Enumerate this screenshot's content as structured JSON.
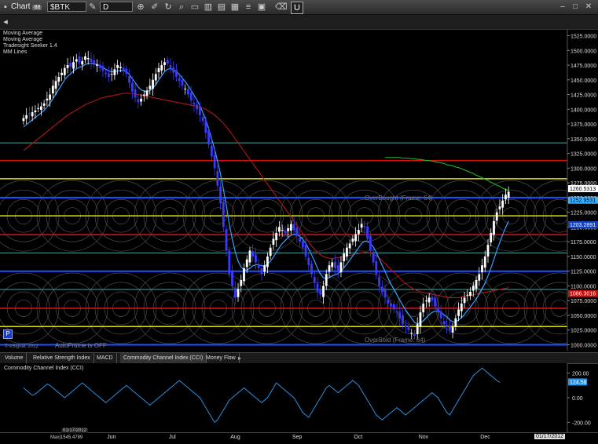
{
  "window": {
    "title": "Chart",
    "badge": "88"
  },
  "toolbar": {
    "symbol": "$BTK",
    "interval": "D",
    "symbol_icon": "edit-icon",
    "icons": [
      "crosshair-icon",
      "pencil-icon",
      "cycle-icon",
      "magnify-icon",
      "ruler-icon",
      "bar-chart-icon",
      "mini-chart-icon",
      "ml-chart-icon",
      "list-icon",
      "calendar-icon",
      "eraser-icon",
      "u-icon"
    ]
  },
  "window_controls": [
    "minimize-icon",
    "maximize-icon",
    "close-icon"
  ],
  "studies": [
    "Moving Average",
    "Moving Average",
    "Tradesight Seeker 1.4",
    "MM Lines"
  ],
  "labels": {
    "overbought": "OverBought (Frame: 64)",
    "oversold": "OverSold (Frame: 64)",
    "autoframe": "AutoFrame is OFF",
    "copyright": "© eSignal, 2012",
    "cci_title": "Commodity Channel Index (CCI)",
    "p_button": "P"
  },
  "tabs": [
    "Volume",
    "Relative Strength Index",
    "MACD",
    "Commodity Channel Index (CCI)",
    "Money Flow"
  ],
  "active_tab": 3,
  "chart_data": {
    "type": "candlestick",
    "y_ticks": [
      "1525.0000",
      "1500.0000",
      "1475.0000",
      "1450.0000",
      "1425.0000",
      "1400.0000",
      "1375.0000",
      "1350.0000",
      "1325.0000",
      "1300.0000",
      "1275.0000",
      "1250.0000",
      "1225.0000",
      "1200.0000",
      "1175.0000",
      "1150.0000",
      "1125.0000",
      "1100.0000",
      "1075.0000",
      "1050.0000",
      "1025.0000",
      "1000.0000"
    ],
    "ylim": [
      990,
      1535
    ],
    "x_ticks": [
      "Jun",
      "Jul",
      "Aug",
      "Sep",
      "Oct",
      "Nov",
      "Dec",
      "2012"
    ],
    "x_ticks_idx": [
      30,
      51,
      72,
      93,
      114,
      136,
      157,
      178
    ],
    "x_range": [
      -8,
      185
    ],
    "price_labels": [
      {
        "text": "1260.5313",
        "value": 1260.5,
        "bg": "#ffffff",
        "fg": "#000000"
      },
      {
        "text": "1252.9531",
        "value": 1252.9,
        "bg": "#3fb0ff",
        "fg": "#000000"
      },
      {
        "text": "1203.2891",
        "value": 1203.3,
        "bg": "#1040c0",
        "fg": "#ffffff"
      },
      {
        "text": "1086.3016",
        "value": 1086.3,
        "bg": "#c01010",
        "fg": "#ffffff"
      }
    ],
    "mm_lines": [
      {
        "value": 1343,
        "color": "#4aa3a3",
        "width": 1
      },
      {
        "value": 1313,
        "color": "#e01010",
        "width": 1.5
      },
      {
        "value": 1282,
        "color": "#e0e000",
        "width": 1.5
      },
      {
        "value": 1250,
        "color": "#2050ff",
        "width": 2
      },
      {
        "value": 1219,
        "color": "#e0e000",
        "width": 1.5
      },
      {
        "value": 1187,
        "color": "#e01010",
        "width": 1.5
      },
      {
        "value": 1156,
        "color": "#4aa3a3",
        "width": 1
      },
      {
        "value": 1125,
        "color": "#2050ff",
        "width": 2
      },
      {
        "value": 1094,
        "color": "#4aa3a3",
        "width": 1
      },
      {
        "value": 1062,
        "color": "#e01010",
        "width": 1.5
      },
      {
        "value": 1031,
        "color": "#e0e000",
        "width": 1.5
      },
      {
        "value": 1000,
        "color": "#2050ff",
        "width": 2
      }
    ],
    "series": [
      {
        "name": "price",
        "color_up": "#ffffff",
        "color_down": "#3a3aff",
        "close": [
          1385,
          1390,
          1392,
          1395,
          1398,
          1402,
          1405,
          1410,
          1418,
          1425,
          1440,
          1448,
          1455,
          1462,
          1470,
          1475,
          1472,
          1480,
          1485,
          1478,
          1482,
          1490,
          1487,
          1480,
          1478,
          1476,
          1470,
          1465,
          1460,
          1455,
          1460,
          1468,
          1475,
          1472,
          1466,
          1460,
          1445,
          1430,
          1420,
          1412,
          1418,
          1425,
          1432,
          1440,
          1450,
          1460,
          1470,
          1475,
          1480,
          1478,
          1470,
          1462,
          1455,
          1448,
          1440,
          1435,
          1425,
          1415,
          1408,
          1400,
          1390,
          1380,
          1360,
          1340,
          1320,
          1300,
          1270,
          1240,
          1200,
          1160,
          1120,
          1100,
          1080,
          1095,
          1110,
          1130,
          1145,
          1160,
          1150,
          1140,
          1130,
          1120,
          1135,
          1150,
          1165,
          1180,
          1190,
          1200,
          1195,
          1190,
          1198,
          1205,
          1195,
          1185,
          1175,
          1165,
          1150,
          1135,
          1120,
          1105,
          1090,
          1085,
          1100,
          1120,
          1135,
          1140,
          1130,
          1125,
          1140,
          1155,
          1165,
          1172,
          1180,
          1188,
          1195,
          1205,
          1200,
          1180,
          1160,
          1140,
          1120,
          1100,
          1090,
          1080,
          1070,
          1065,
          1060,
          1055,
          1045,
          1035,
          1030,
          1025,
          1020,
          1015,
          1035,
          1055,
          1070,
          1075,
          1080,
          1075,
          1065,
          1055,
          1045,
          1035,
          1030,
          1025,
          1030,
          1045,
          1060,
          1070,
          1080,
          1085,
          1090,
          1100,
          1110,
          1120,
          1135,
          1150,
          1170,
          1190,
          1210,
          1225,
          1235,
          1245,
          1255,
          1260
        ]
      },
      {
        "name": "ma_fast",
        "color": "#3aa0ff",
        "values": [
          1370,
          1374,
          1378,
          1382,
          1386,
          1390,
          1394,
          1398,
          1404,
          1410,
          1418,
          1426,
          1434,
          1442,
          1450,
          1456,
          1460,
          1465,
          1469,
          1471,
          1473,
          1476,
          1478,
          1478,
          1477,
          1476,
          1474,
          1471,
          1468,
          1465,
          1464,
          1464,
          1465,
          1466,
          1466,
          1464,
          1459,
          1452,
          1445,
          1438,
          1433,
          1431,
          1430,
          1432,
          1436,
          1442,
          1450,
          1457,
          1464,
          1468,
          1469,
          1467,
          1464,
          1459,
          1453,
          1447,
          1440,
          1432,
          1424,
          1416,
          1406,
          1395,
          1382,
          1367,
          1350,
          1332,
          1312,
          1290,
          1264,
          1236,
          1205,
          1180,
          1158,
          1142,
          1132,
          1127,
          1127,
          1130,
          1134,
          1136,
          1136,
          1134,
          1134,
          1137,
          1142,
          1149,
          1157,
          1165,
          1172,
          1177,
          1182,
          1186,
          1188,
          1187,
          1184,
          1179,
          1172,
          1163,
          1153,
          1142,
          1130,
          1120,
          1114,
          1112,
          1114,
          1117,
          1119,
          1121,
          1125,
          1131,
          1137,
          1144,
          1151,
          1158,
          1165,
          1172,
          1176,
          1176,
          1172,
          1166,
          1157,
          1146,
          1135,
          1124,
          1113,
          1103,
          1094,
          1085,
          1076,
          1067,
          1059,
          1052,
          1045,
          1038,
          1036,
          1037,
          1041,
          1046,
          1051,
          1055,
          1057,
          1057,
          1055,
          1051,
          1047,
          1042,
          1039,
          1039,
          1042,
          1046,
          1052,
          1058,
          1064,
          1071,
          1078,
          1086,
          1095,
          1105,
          1117,
          1130,
          1145,
          1160,
          1174,
          1187,
          1199,
          1210
        ]
      },
      {
        "name": "ma_slow",
        "color": "#c01818",
        "values": [
          1330,
          1334,
          1338,
          1342,
          1346,
          1350,
          1354,
          1358,
          1362,
          1366,
          1370,
          1374,
          1378,
          1382,
          1386,
          1390,
          1393,
          1396,
          1399,
          1402,
          1405,
          1408,
          1410,
          1412,
          1414,
          1416,
          1418,
          1420,
          1421,
          1422,
          1423,
          1424,
          1425,
          1426,
          1427,
          1427,
          1427,
          1427,
          1426,
          1425,
          1424,
          1423,
          1422,
          1421,
          1420,
          1419,
          1418,
          1417,
          1416,
          1415,
          1414,
          1413,
          1412,
          1411,
          1410,
          1409,
          1408,
          1407,
          1406,
          1405,
          1404,
          1402,
          1400,
          1397,
          1394,
          1390,
          1386,
          1381,
          1376,
          1370,
          1364,
          1357,
          1350,
          1343,
          1336,
          1329,
          1322,
          1315,
          1308,
          1301,
          1294,
          1287,
          1280,
          1273,
          1266,
          1259,
          1252,
          1245,
          1238,
          1231,
          1224,
          1217,
          1210,
          1203,
          1196,
          1189,
          1182,
          1175,
          1168,
          1162,
          1157,
          1153,
          1150,
          1148,
          1147,
          1147,
          1147,
          1148,
          1149,
          1150,
          1151,
          1152,
          1153,
          1154,
          1155,
          1156,
          1157,
          1157,
          1156,
          1154,
          1151,
          1147,
          1143,
          1138,
          1133,
          1128,
          1123,
          1118,
          1113,
          1108,
          1104,
          1100,
          1097,
          1094,
          1092,
          1090,
          1089,
          1088,
          1087,
          1086,
          1085,
          1084,
          1083,
          1082,
          1081,
          1080,
          1080,
          1080,
          1080,
          1081,
          1082,
          1083,
          1084,
          1085,
          1086,
          1087,
          1088,
          1089,
          1090,
          1091,
          1092,
          1093,
          1094,
          1095,
          1096,
          1097
        ]
      },
      {
        "name": "ma_long",
        "color": "#20c020",
        "values": [
          1318,
          1318,
          1318,
          1318,
          1318,
          1318,
          1317,
          1317,
          1317,
          1316,
          1316,
          1315,
          1315,
          1314,
          1313,
          1313,
          1312,
          1311,
          1310,
          1309,
          1308,
          1306,
          1305,
          1304,
          1302,
          1301,
          1299,
          1297,
          1295,
          1293,
          1291,
          1288,
          1286,
          1284,
          1281,
          1279,
          1276,
          1274,
          1271,
          1269,
          1266,
          1264,
          1262
        ]
      },
      {
        "name": "cci",
        "color": "#2a90e0",
        "values": [
          80,
          60,
          40,
          20,
          30,
          50,
          70,
          90,
          110,
          100,
          80,
          60,
          40,
          20,
          0,
          20,
          40,
          60,
          80,
          100,
          120,
          100,
          80,
          60,
          40,
          20,
          0,
          -20,
          -40,
          -20,
          0,
          20,
          40,
          60,
          80,
          100,
          80,
          60,
          40,
          20,
          0,
          -20,
          -40,
          -60,
          -40,
          -20,
          0,
          20,
          40,
          60,
          80,
          100,
          120,
          140,
          120,
          100,
          80,
          60,
          40,
          20,
          0,
          -40,
          -80,
          -120,
          -160,
          -200,
          -180,
          -140,
          -100,
          -60,
          -20,
          0,
          20,
          40,
          60,
          80,
          60,
          40,
          20,
          0,
          -20,
          -40,
          -20,
          0,
          40,
          80,
          120,
          100,
          80,
          60,
          40,
          20,
          0,
          -40,
          -80,
          -120,
          -140,
          -160,
          -120,
          -80,
          -40,
          0,
          40,
          80,
          100,
          80,
          60,
          40,
          60,
          80,
          100,
          120,
          140,
          120,
          100,
          60,
          20,
          -20,
          -60,
          -100,
          -140,
          -160,
          -180,
          -160,
          -140,
          -120,
          -100,
          -80,
          -100,
          -120,
          -140,
          -120,
          -100,
          -80,
          -60,
          -40,
          -20,
          0,
          20,
          40,
          20,
          0,
          -40,
          -80,
          -120,
          -140,
          -100,
          -60,
          -20,
          20,
          60,
          100,
          140,
          180,
          200,
          220,
          240,
          220,
          200,
          180,
          160,
          140,
          124.58
        ]
      }
    ],
    "cci_ticks": [
      "200.00",
      "0.00",
      "-200.00"
    ],
    "cci_ylim": [
      -280,
      280
    ],
    "cci_value_label": "124.58",
    "x_axis_date_label": "01/17/2012",
    "x_axis_bottom_label": "Max|1545.4789"
  }
}
